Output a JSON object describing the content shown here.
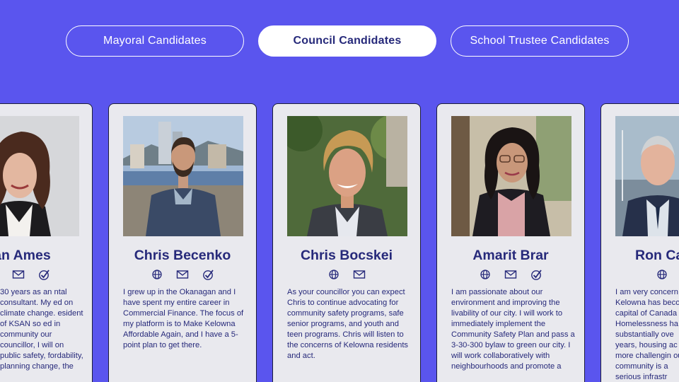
{
  "tabs": [
    {
      "label": "Mayoral Candidates",
      "active": false
    },
    {
      "label": "Council Candidates",
      "active": true
    },
    {
      "label": "School Trustee Candidates",
      "active": false
    }
  ],
  "candidates": [
    {
      "name": "san Ames",
      "icons": [
        "globe-icon",
        "mail-icon",
        "check-badge-icon"
      ],
      "bio": "30 years as an ntal consultant. My ed on climate change. esident of KSAN so ed in community our councillor, I will on public safety, fordability, planning change, the"
    },
    {
      "name": "Chris Becenko",
      "icons": [
        "globe-icon",
        "mail-icon",
        "check-badge-icon"
      ],
      "bio": "I grew up in the Okanagan and I have spent my entire career in Commercial Finance. The focus of my platform is to Make Kelowna Affordable Again, and I have a 5-point plan to get there."
    },
    {
      "name": "Chris Bocskei",
      "icons": [
        "globe-icon",
        "mail-icon"
      ],
      "bio": "As your councillor you can expect Chris to continue advocating for community safety programs, safe senior programs, and youth and teen programs. Chris will listen to the concerns of Kelowna residents and act."
    },
    {
      "name": "Amarit Brar",
      "icons": [
        "globe-icon",
        "mail-icon",
        "check-badge-icon"
      ],
      "bio": "I am passionate about our environment and improving the livability of our city. I will work to immediately implement the Community Safety Plan and pass a 3-30-300 bylaw to green our city. I will work collaboratively with neighbourhoods and promote a"
    },
    {
      "name": "Ron Ca",
      "icons": [
        "globe-icon"
      ],
      "bio": "I am very concern Kelowna has beco capital of Canada Homelessness ha substantially ove years, housing ac more challengin our community is a serious infrastr"
    }
  ],
  "colors": {
    "background": "#5a55ee",
    "card": "#e9e9ee",
    "text": "#26297a"
  }
}
